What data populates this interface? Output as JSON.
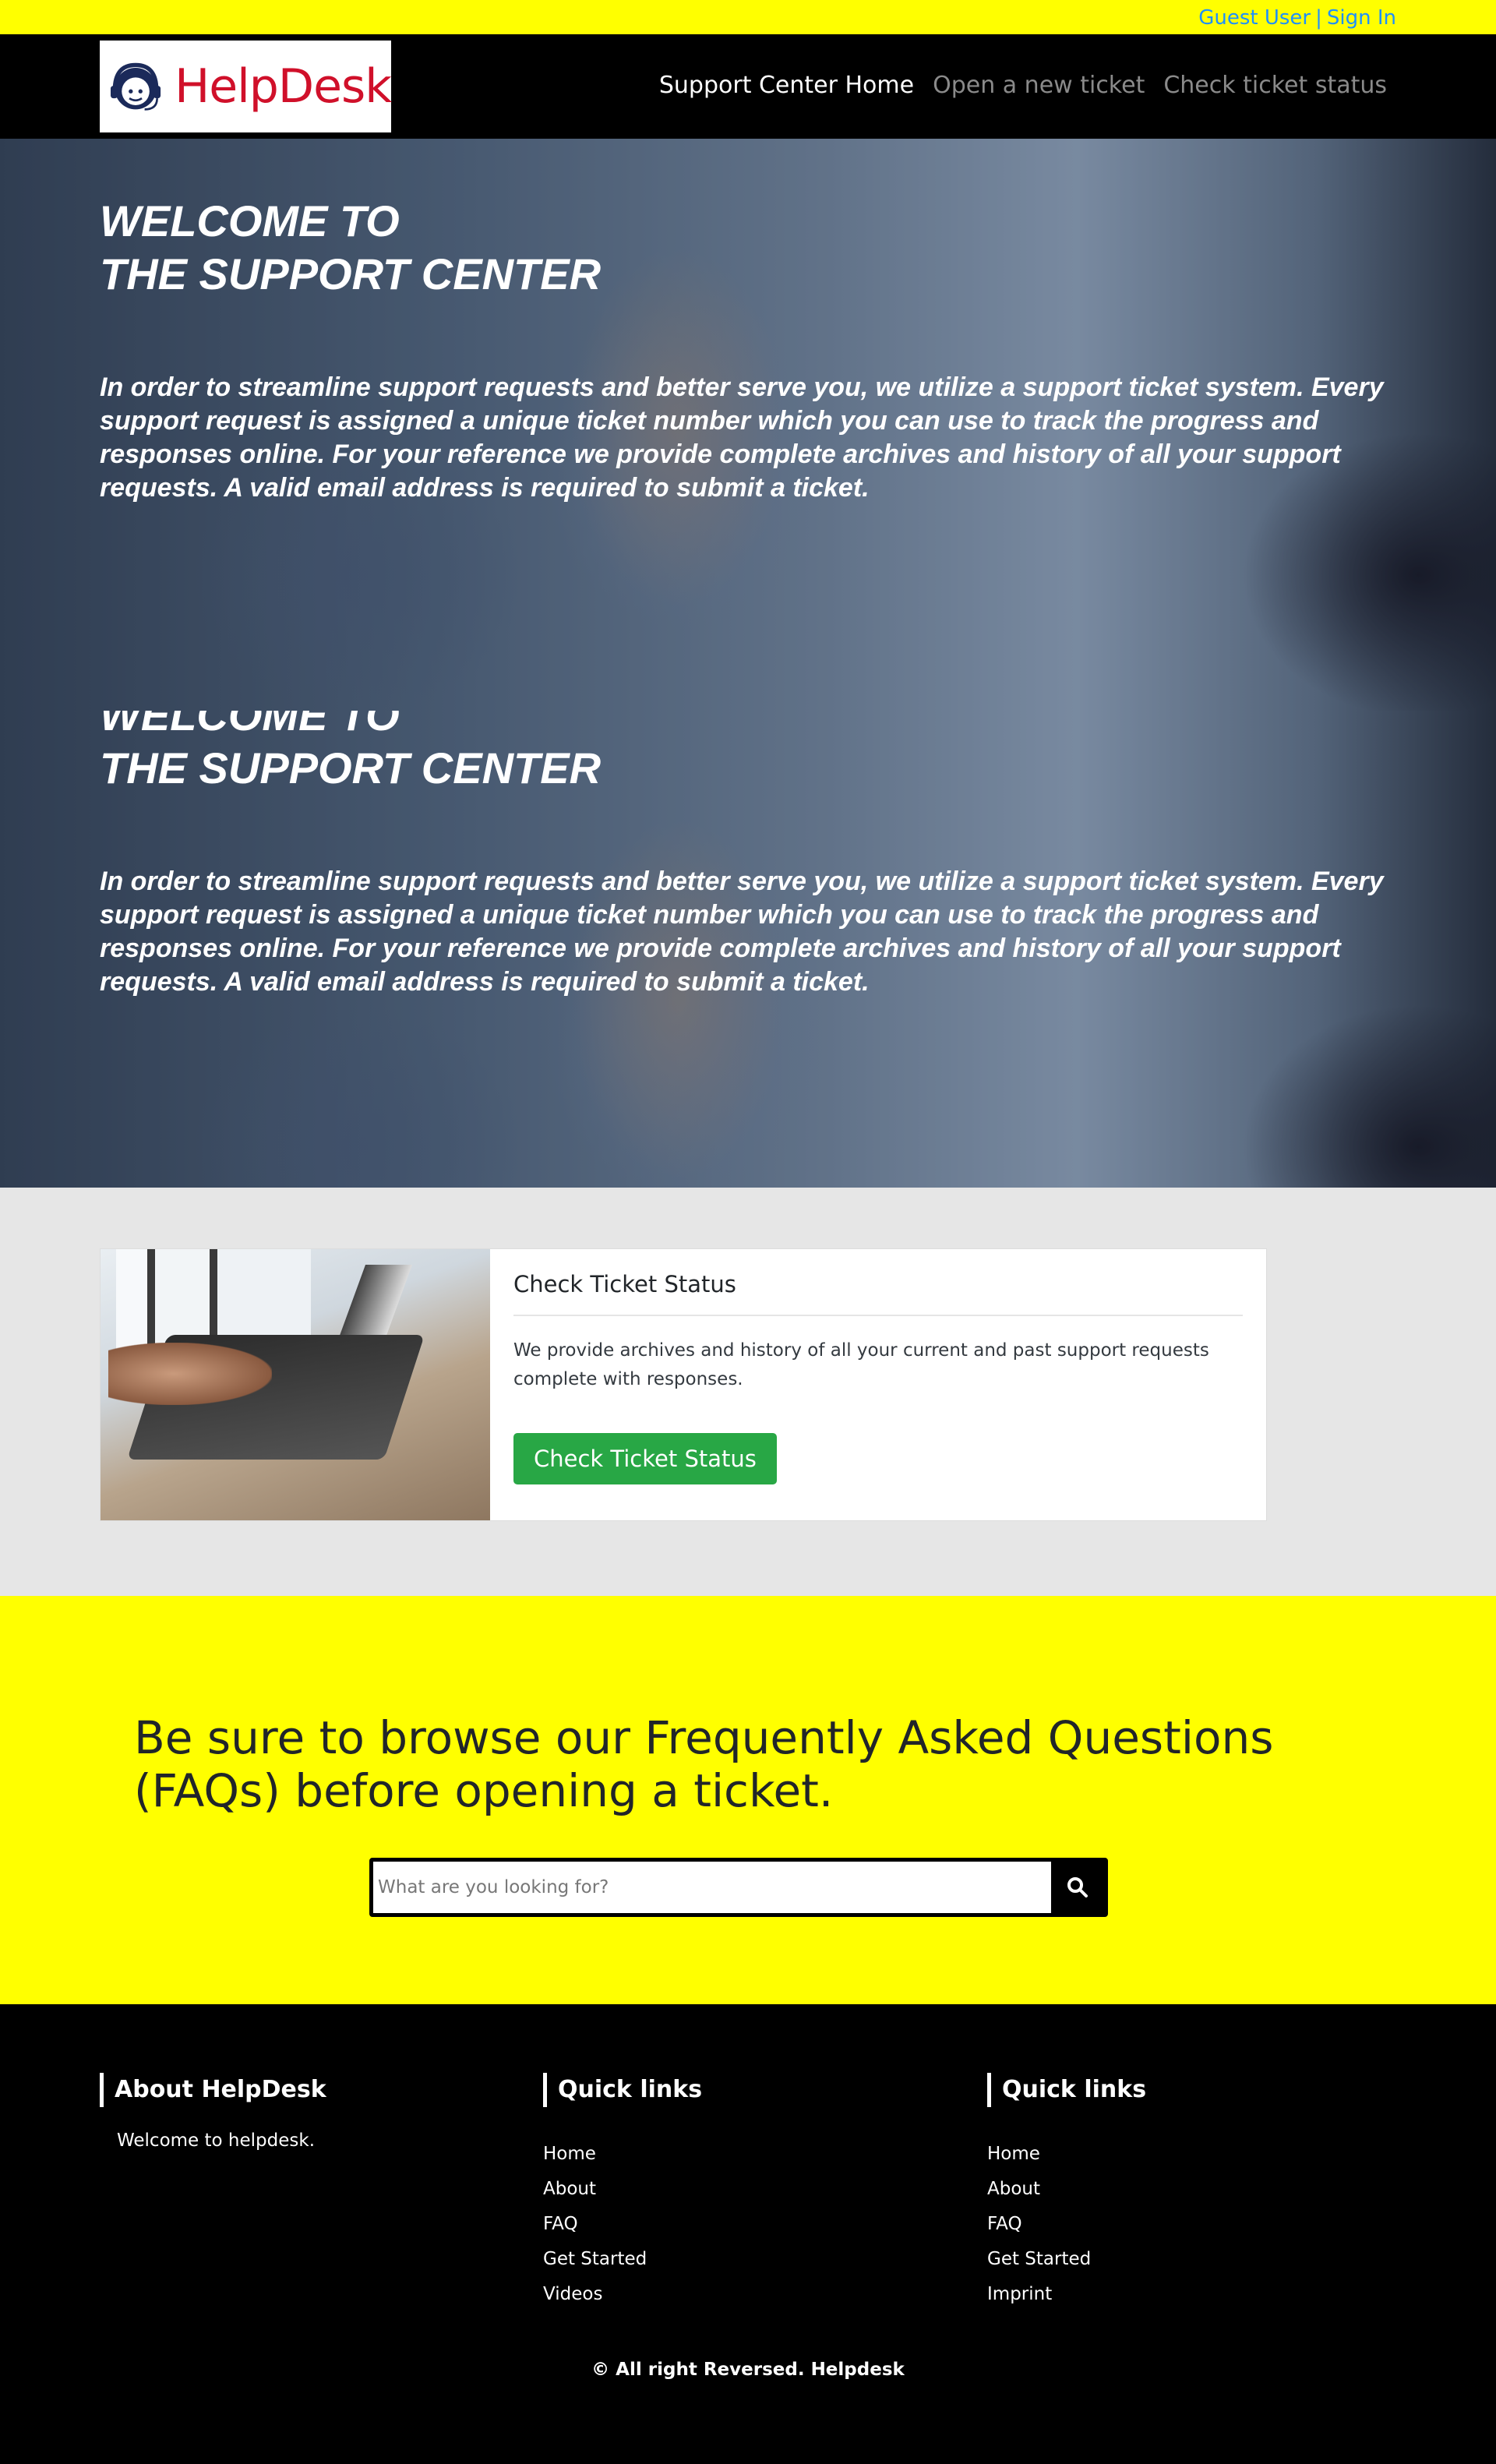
{
  "topbar": {
    "guest": "Guest User",
    "separator": "|",
    "sign_in": "Sign In"
  },
  "brand": {
    "name": "HelpDesk"
  },
  "nav": {
    "items": [
      {
        "label": "Support Center Home",
        "active": true
      },
      {
        "label": "Open a new ticket",
        "active": false
      },
      {
        "label": "Check ticket status",
        "active": false
      }
    ]
  },
  "hero": {
    "title_line1": "WELCOME TO",
    "title_line2": "THE SUPPORT CENTER",
    "text": "In order to streamline support requests and better serve you, we utilize a support ticket system. Every support request is assigned a unique ticket number which you can use to track the progress and responses online. For your reference we provide complete archives and history of all your support requests. A valid email address is required to submit a ticket."
  },
  "ticket_card": {
    "title": "Check Ticket Status",
    "text": "We provide archives and history of all your current and past support requests complete with responses.",
    "button": "Check Ticket Status"
  },
  "faq": {
    "heading": "Be sure to browse our Frequently Asked Questions (FAQs) before opening a ticket.",
    "search_placeholder": "What are you looking for?"
  },
  "footer": {
    "about": {
      "title": "About HelpDesk",
      "text": "Welcome to helpdesk."
    },
    "col2": {
      "title": "Quick links",
      "links": [
        "Home",
        "About",
        "FAQ",
        "Get Started",
        "Videos"
      ]
    },
    "col3": {
      "title": "Quick links",
      "links": [
        "Home",
        "About",
        "FAQ",
        "Get Started",
        "Imprint"
      ]
    },
    "copyright": "© All right Reversed.  Helpdesk"
  },
  "colors": {
    "topbar": "#ffff00",
    "accent_link": "#1e90ff",
    "brand_red": "#d0102a",
    "success": "#28a745"
  }
}
